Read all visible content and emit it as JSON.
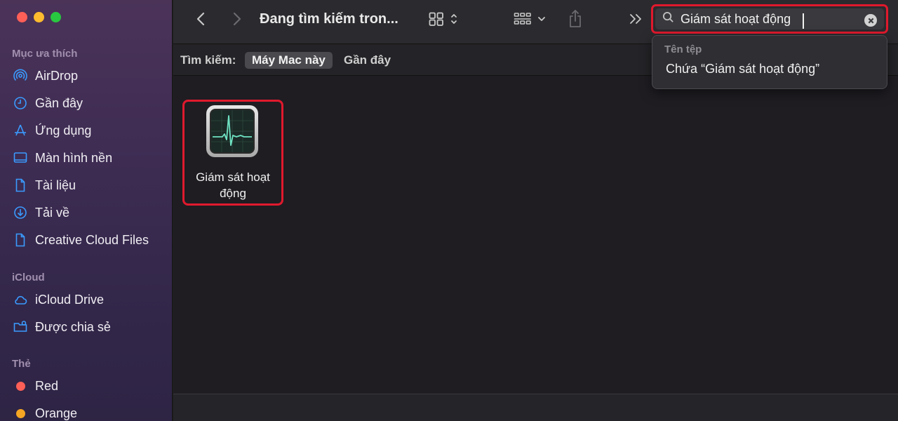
{
  "window": {
    "title": "Đang tìm kiếm tron..."
  },
  "sidebar": {
    "favorites_title": "Mục ưa thích",
    "favorites": [
      {
        "label": "AirDrop",
        "icon": "airdrop-icon"
      },
      {
        "label": "Gần đây",
        "icon": "clock-icon"
      },
      {
        "label": "Ứng dụng",
        "icon": "applications-icon"
      },
      {
        "label": "Màn hình nền",
        "icon": "desktop-icon"
      },
      {
        "label": "Tài liệu",
        "icon": "document-icon"
      },
      {
        "label": "Tải về",
        "icon": "download-icon"
      },
      {
        "label": "Creative Cloud Files",
        "icon": "file-icon"
      }
    ],
    "icloud_title": "iCloud",
    "icloud": [
      {
        "label": "iCloud Drive",
        "icon": "cloud-icon"
      },
      {
        "label": "Được chia sẻ",
        "icon": "shared-folder-icon"
      }
    ],
    "tags_title": "Thẻ",
    "tags": [
      {
        "label": "Red",
        "color": "#fe5f57"
      },
      {
        "label": "Orange",
        "color": "#f5a623"
      }
    ]
  },
  "search": {
    "value": "Giám sát hoạt động",
    "suggestions_heading": "Tên tệp",
    "suggestion": "Chứa “Giám sát hoạt động”"
  },
  "scope": {
    "label": "Tìm kiếm:",
    "selected": "Máy Mac này",
    "other": "Gần đây"
  },
  "results": [
    {
      "name": "Giám sát hoạt động",
      "icon": "activity-monitor-icon"
    }
  ],
  "colors": {
    "accent": "#3a9bff",
    "highlight": "#e0192d"
  }
}
